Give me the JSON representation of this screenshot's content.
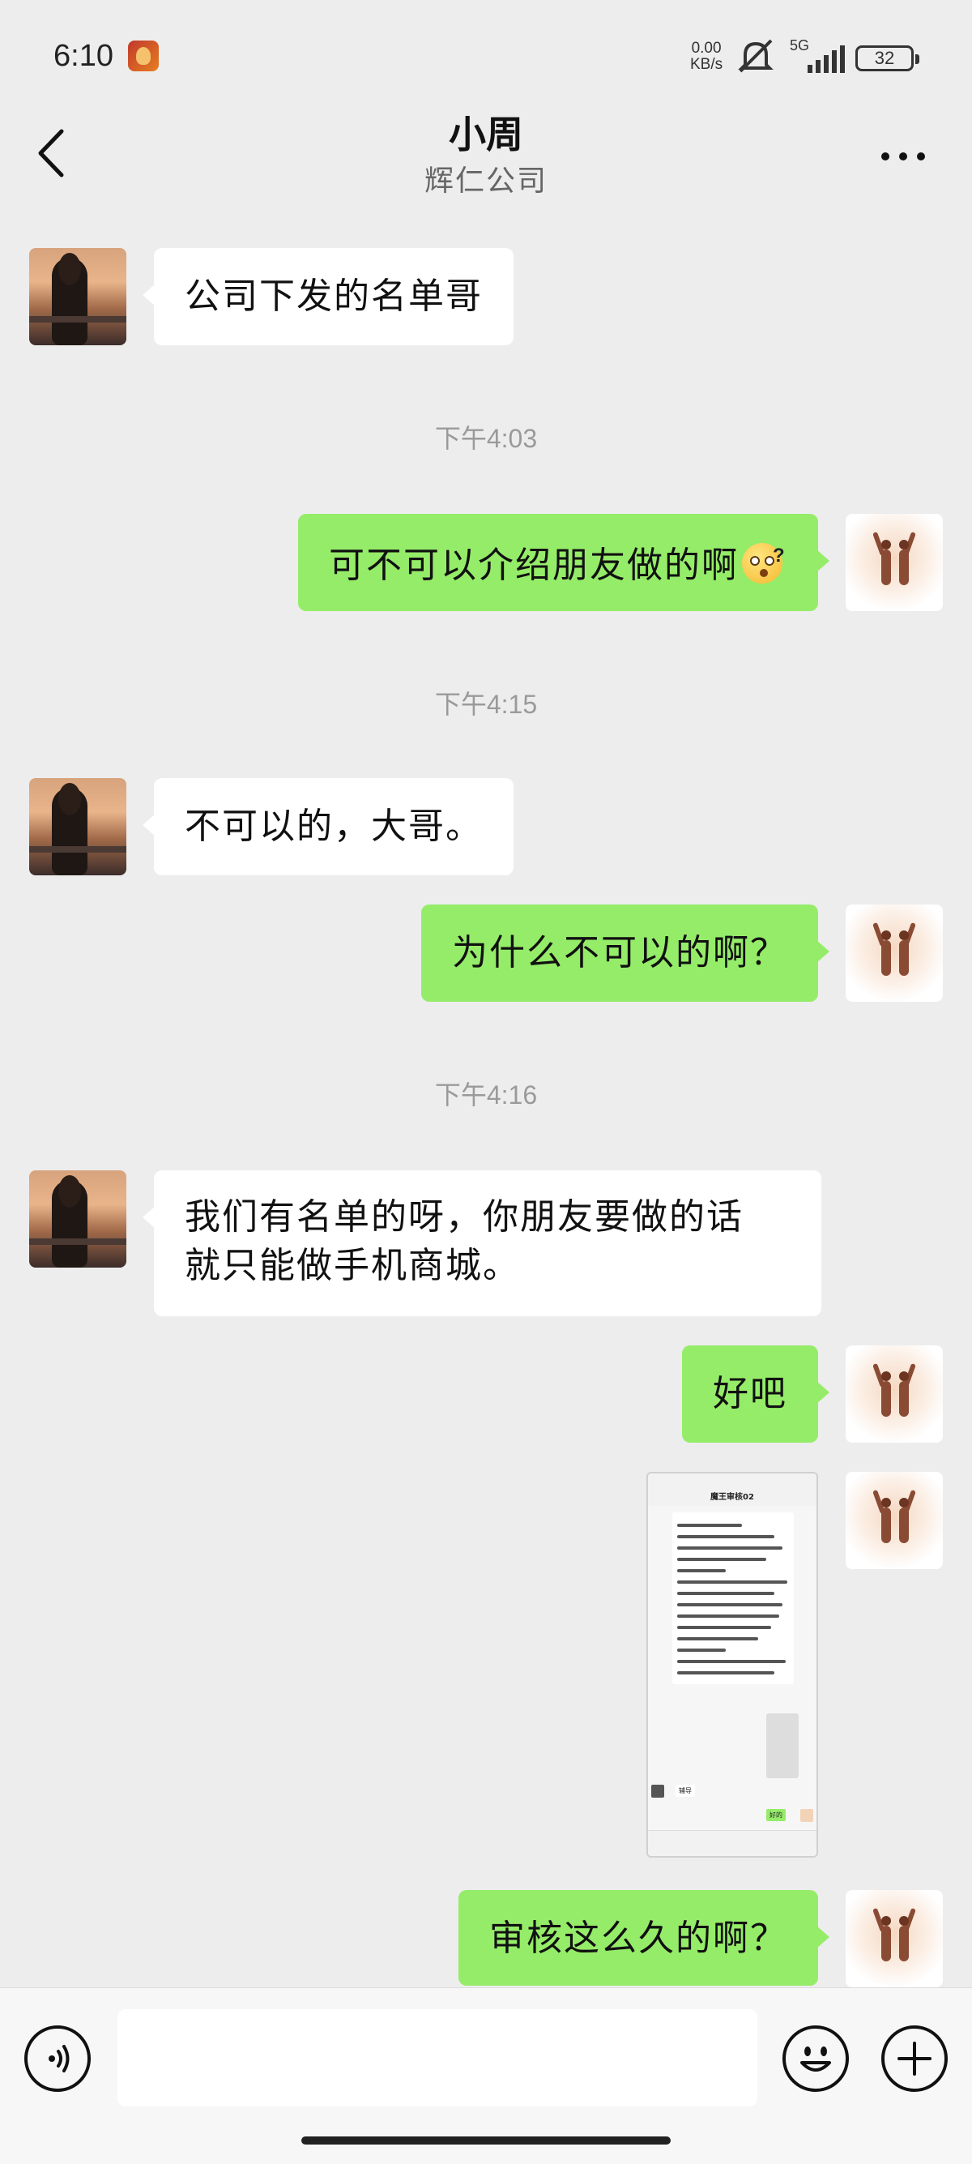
{
  "status_bar": {
    "time": "6:10",
    "net_speed_value": "0.00",
    "net_speed_unit": "KB/s",
    "network_type": "5G",
    "battery": "32"
  },
  "header": {
    "title": "小周",
    "subtitle": "辉仁公司"
  },
  "messages": [
    {
      "side": "left",
      "text": "公司下发的名单哥"
    },
    {
      "type": "time",
      "text": "下午4:03"
    },
    {
      "side": "right",
      "text": "可不可以介绍朋友做的啊",
      "emoji": "surprised-question-emoji"
    },
    {
      "type": "time",
      "text": "下午4:15"
    },
    {
      "side": "left",
      "text": "不可以的，大哥。"
    },
    {
      "side": "right",
      "text": "为什么不可以的啊？"
    },
    {
      "type": "time",
      "text": "下午4:16"
    },
    {
      "side": "left",
      "text_line1": "我们有名单的呀，你朋友要做的话",
      "text_line2": "就只能做手机商城。"
    },
    {
      "side": "right",
      "text": "好吧"
    },
    {
      "side": "right",
      "type": "image",
      "thumb_title": "魔王审核02",
      "thumb_ok": "好的"
    },
    {
      "side": "right",
      "text": "审核这么久的啊？"
    }
  ],
  "input_bar": {
    "placeholder": ""
  },
  "icons": {
    "back": "chevron-left-icon",
    "more": "more-dots-icon",
    "voice": "voice-icon",
    "emoji": "smiley-icon",
    "plus": "plus-icon",
    "mute": "mute-bell-icon"
  }
}
